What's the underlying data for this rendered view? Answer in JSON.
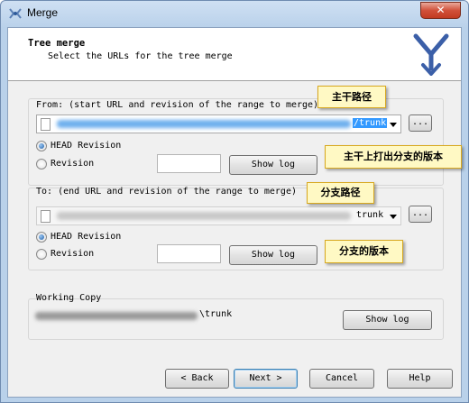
{
  "window": {
    "title": "Merge",
    "close_glyph": "✕",
    "app_icon": "merge-icon"
  },
  "header": {
    "title": "Tree merge",
    "subtitle": "Select the URLs for the tree merge",
    "logo_icon": "branch-merge-icon"
  },
  "from": {
    "label": "From: (start URL and revision of the range to merge)",
    "url_visible_tail": "/trunk",
    "browse_label": "...",
    "head_label": "HEAD Revision",
    "revision_label": "Revision",
    "revision_value": "",
    "selected": "HEAD Revision",
    "show_log_label": "Show log"
  },
  "to": {
    "label": "To: (end URL and revision of the range to merge)",
    "url_visible_tail": "trunk",
    "browse_label": "...",
    "head_label": "HEAD Revision",
    "revision_label": "Revision",
    "revision_value": "",
    "selected": "HEAD Revision",
    "show_log_label": "Show log"
  },
  "working_copy": {
    "label": "Working Copy",
    "path_visible_tail": "\\trunk",
    "show_log_label": "Show log"
  },
  "footer": {
    "back_label": "< Back",
    "next_label": "Next >",
    "cancel_label": "Cancel",
    "help_label": "Help"
  },
  "annotations": {
    "trunk_path": "主干路径",
    "trunk_branch_version": "主干上打出分支的版本",
    "branch_path": "分支路径",
    "branch_version": "分支的版本"
  },
  "colors": {
    "accent_blue": "#3399ff",
    "callout_fill": "#fff9c4",
    "callout_border": "#d8a81f",
    "close_red": "#c23a21"
  }
}
